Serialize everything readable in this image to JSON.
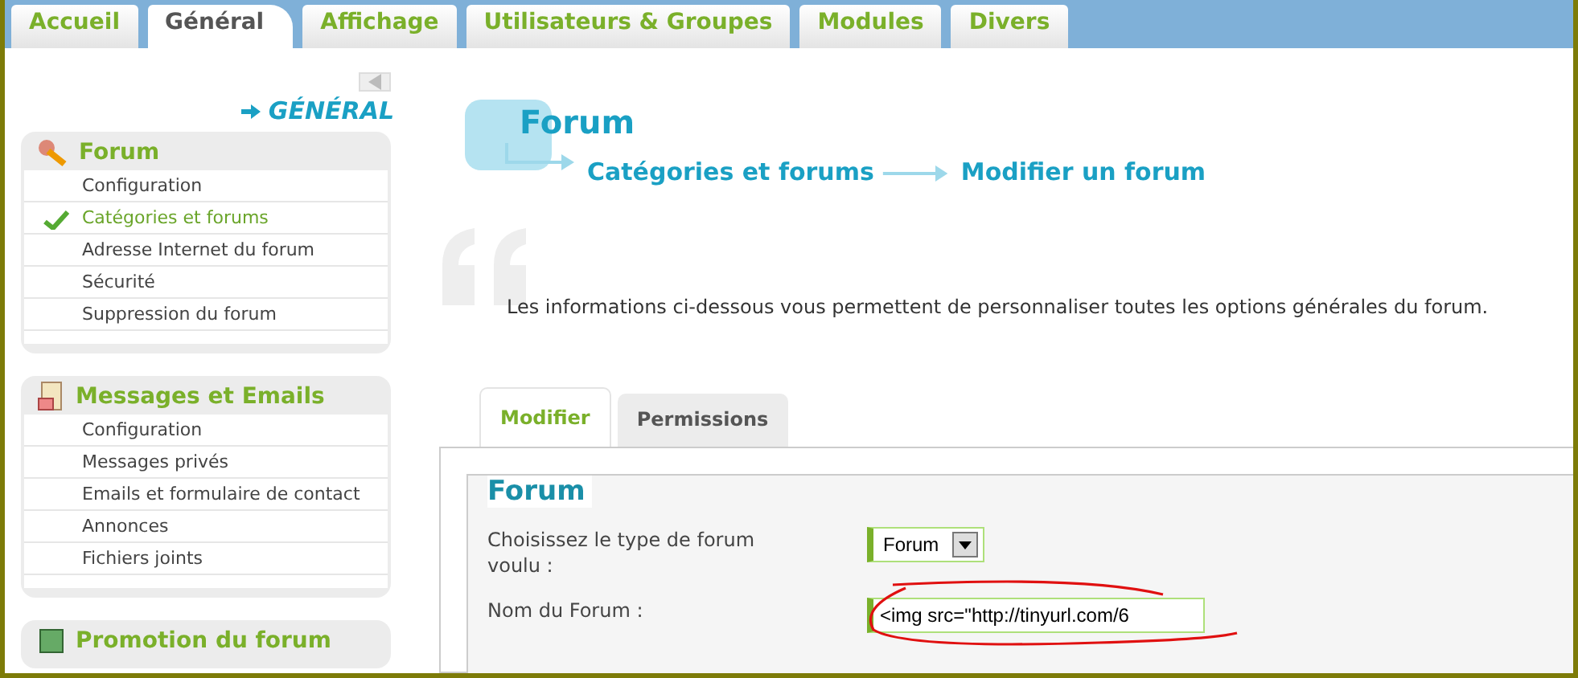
{
  "tabs": [
    {
      "label": "Accueil",
      "selected": false
    },
    {
      "label": "Général",
      "selected": true
    },
    {
      "label": "Affichage",
      "selected": false
    },
    {
      "label": "Utilisateurs & Groupes",
      "selected": false
    },
    {
      "label": "Modules",
      "selected": false
    },
    {
      "label": "Divers",
      "selected": false
    }
  ],
  "sidebar": {
    "section_heading": "GÉNÉRAL",
    "groups": [
      {
        "title": "Forum",
        "items": [
          {
            "label": "Configuration",
            "selected": false
          },
          {
            "label": "Catégories et forums",
            "selected": true
          },
          {
            "label": "Adresse Internet du forum",
            "selected": false
          },
          {
            "label": "Sécurité",
            "selected": false
          },
          {
            "label": "Suppression du forum",
            "selected": false
          }
        ]
      },
      {
        "title": "Messages et Emails",
        "items": [
          {
            "label": "Configuration",
            "selected": false
          },
          {
            "label": "Messages privés",
            "selected": false
          },
          {
            "label": "Emails et formulaire de contact",
            "selected": false
          },
          {
            "label": "Annonces",
            "selected": false
          },
          {
            "label": "Fichiers joints",
            "selected": false
          }
        ]
      },
      {
        "title": "Promotion du forum"
      }
    ]
  },
  "page": {
    "title": "Forum",
    "breadcrumb": [
      "Catégories et forums",
      "Modifier un forum"
    ],
    "description": "Les informations ci-dessous vous permettent de personnaliser toutes les options générales du forum."
  },
  "subtabs": [
    {
      "label": "Modifier",
      "selected": true
    },
    {
      "label": "Permissions",
      "selected": false
    }
  ],
  "fieldset": {
    "legend": "Forum",
    "fields": [
      {
        "kind": "select",
        "label": "Choisissez le type de forum voulu :",
        "value": "Forum"
      },
      {
        "kind": "text",
        "label": "Nom du Forum :",
        "value": "<img src=\"http://tinyurl.com/6",
        "annotated": true
      }
    ]
  }
}
